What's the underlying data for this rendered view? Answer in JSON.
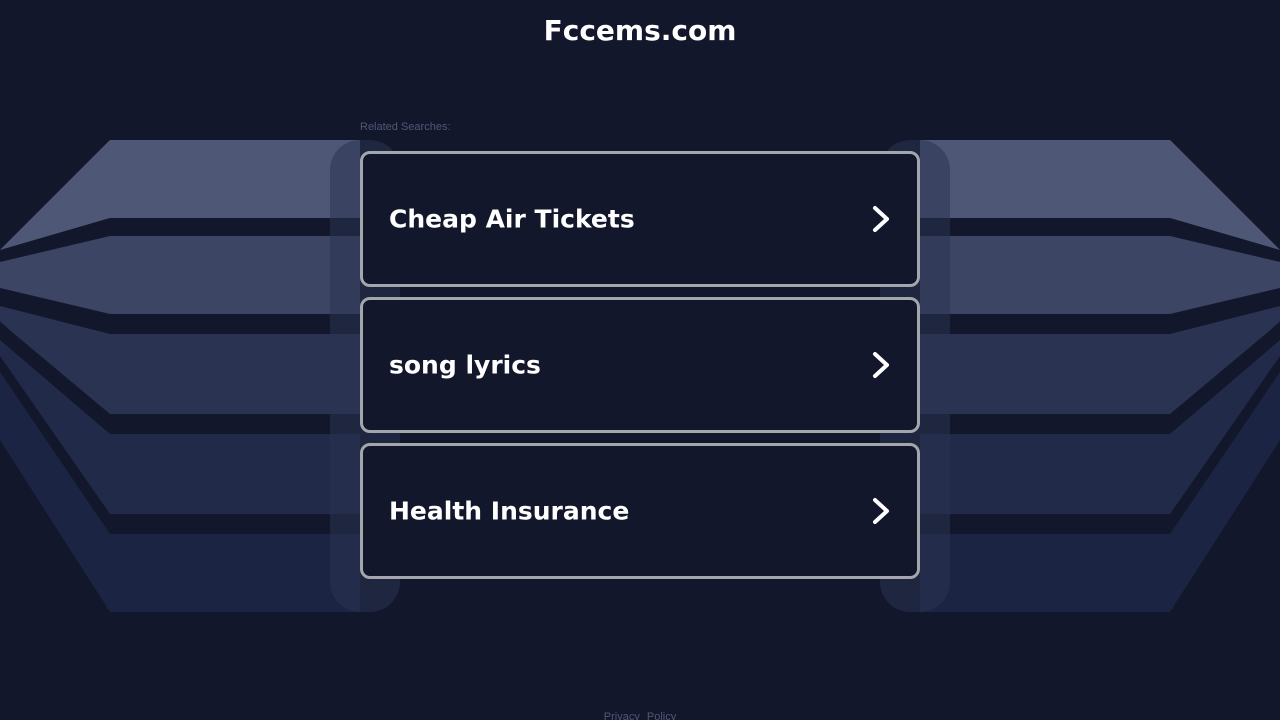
{
  "site": {
    "title": "Fccems.com"
  },
  "related": {
    "heading": "Related Searches:",
    "items": [
      {
        "label": "Cheap Air Tickets",
        "icon": "chevron-right-icon"
      },
      {
        "label": "song lyrics",
        "icon": "chevron-right-icon"
      },
      {
        "label": "Health Insurance",
        "icon": "chevron-right-icon"
      }
    ]
  },
  "footer": {
    "links": [
      {
        "label": "Privacy"
      },
      {
        "label": "Policy"
      }
    ]
  },
  "colors": {
    "background": "#12172b",
    "card_border": "#a3a6ab",
    "text": "#ffffff",
    "muted_text": "#4f5875",
    "band_1": "#4e5775",
    "band_2": "#3c4563",
    "band_3": "#2a3352",
    "band_4": "#212a48",
    "band_5": "#1c2443"
  }
}
